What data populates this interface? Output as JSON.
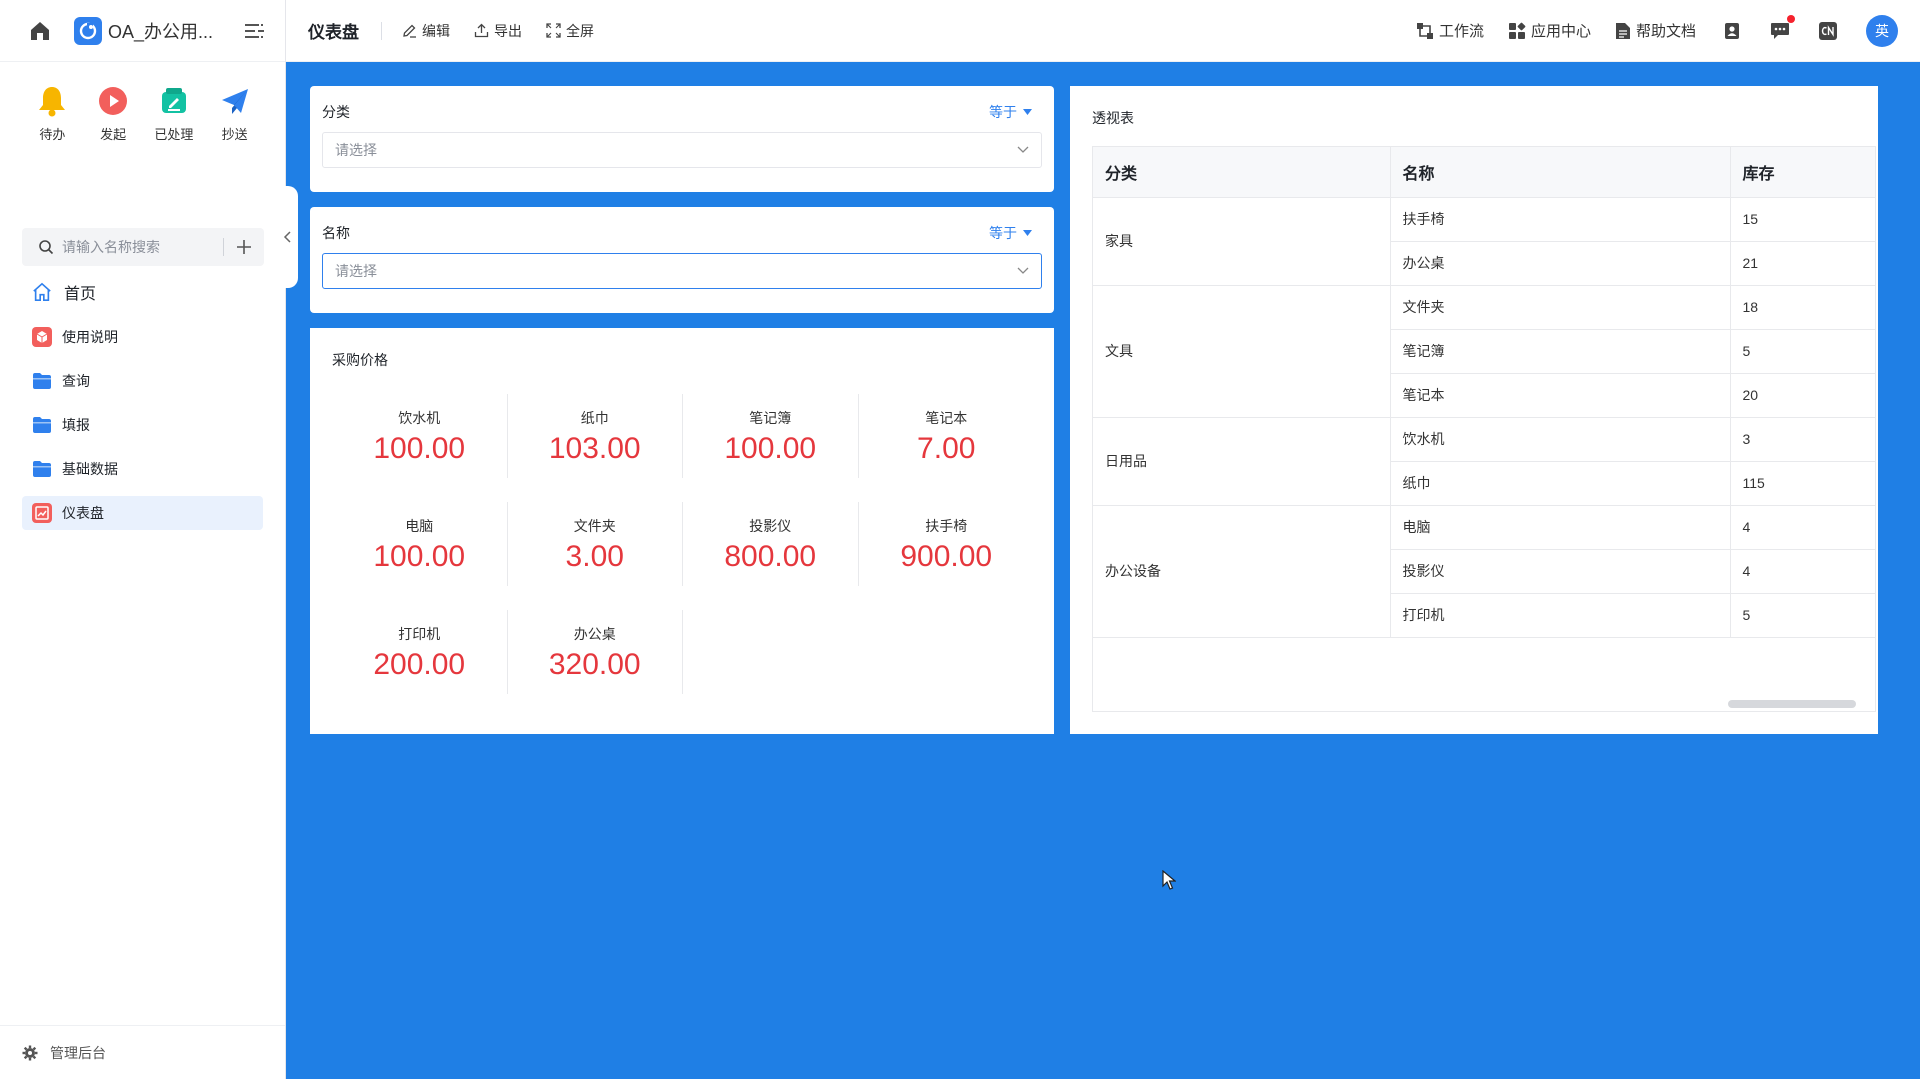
{
  "sidebar": {
    "app_name": "OA_办公用...",
    "quick": [
      {
        "label": "待办",
        "icon": "bell-icon",
        "color": "#f7b500"
      },
      {
        "label": "发起",
        "icon": "play-icon",
        "color": "#f25f5c"
      },
      {
        "label": "已处理",
        "icon": "done-icon",
        "color": "#13c2a3"
      },
      {
        "label": "抄送",
        "icon": "send-icon",
        "color": "#2f80ed"
      }
    ],
    "search_placeholder": "请输入名称搜索",
    "nav": [
      {
        "label": "首页",
        "icon": "home-icon"
      },
      {
        "label": "使用说明",
        "icon": "doc-icon"
      },
      {
        "label": "查询",
        "icon": "folder-icon"
      },
      {
        "label": "填报",
        "icon": "folder-icon"
      },
      {
        "label": "基础数据",
        "icon": "folder-icon"
      },
      {
        "label": "仪表盘",
        "icon": "dashboard-icon",
        "active": true
      }
    ],
    "admin_label": "管理后台"
  },
  "header": {
    "title": "仪表盘",
    "actions": {
      "edit": "编辑",
      "export": "导出",
      "fullscreen": "全屏"
    },
    "right": {
      "workflow": "工作流",
      "app_center": "应用中心",
      "help": "帮助文档",
      "avatar": "英"
    }
  },
  "filters": [
    {
      "title": "分类",
      "operator": "等于",
      "placeholder": "请选择"
    },
    {
      "title": "名称",
      "operator": "等于",
      "placeholder": "请选择"
    }
  ],
  "price_card": {
    "title": "采购价格",
    "items": [
      {
        "label": "饮水机",
        "value": "100.00"
      },
      {
        "label": "纸巾",
        "value": "103.00"
      },
      {
        "label": "笔记簿",
        "value": "100.00"
      },
      {
        "label": "笔记本",
        "value": "7.00"
      },
      {
        "label": "电脑",
        "value": "100.00"
      },
      {
        "label": "文件夹",
        "value": "3.00"
      },
      {
        "label": "投影仪",
        "value": "800.00"
      },
      {
        "label": "扶手椅",
        "value": "900.00"
      },
      {
        "label": "打印机",
        "value": "200.00"
      },
      {
        "label": "办公桌",
        "value": "320.00"
      }
    ]
  },
  "pivot": {
    "title": "透视表",
    "columns": [
      "分类",
      "名称",
      "库存"
    ],
    "groups": [
      {
        "category": "家具",
        "rows": [
          {
            "name": "扶手椅",
            "stock": "15"
          },
          {
            "name": "办公桌",
            "stock": "21"
          }
        ]
      },
      {
        "category": "文具",
        "rows": [
          {
            "name": "文件夹",
            "stock": "18"
          },
          {
            "name": "笔记簿",
            "stock": "5"
          },
          {
            "name": "笔记本",
            "stock": "20"
          }
        ]
      },
      {
        "category": "日用品",
        "rows": [
          {
            "name": "饮水机",
            "stock": "3"
          },
          {
            "name": "纸巾",
            "stock": "115"
          }
        ]
      },
      {
        "category": "办公设备",
        "rows": [
          {
            "name": "电脑",
            "stock": "4"
          },
          {
            "name": "投影仪",
            "stock": "4"
          },
          {
            "name": "打印机",
            "stock": "5"
          }
        ]
      }
    ]
  },
  "colors": {
    "primary": "#2f80ed",
    "canvas": "#1f7fe5",
    "price": "#e5373d"
  }
}
